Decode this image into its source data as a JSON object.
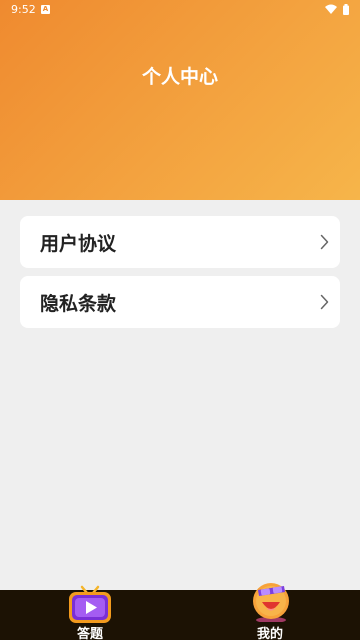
{
  "status": {
    "time": "9:52",
    "indicator": "A"
  },
  "header": {
    "title": "个人中心"
  },
  "menu": [
    {
      "label": "用户协议"
    },
    {
      "label": "隐私条款"
    }
  ],
  "tabs": [
    {
      "label": "答题",
      "icon": "tv-play-icon"
    },
    {
      "label": "我的",
      "icon": "smiley-sunglasses-icon"
    }
  ],
  "colors": {
    "header_start": "#ef8a2f",
    "header_end": "#f6b54a",
    "tabbar_bg": "#1c1204",
    "page_bg": "#efefef"
  }
}
